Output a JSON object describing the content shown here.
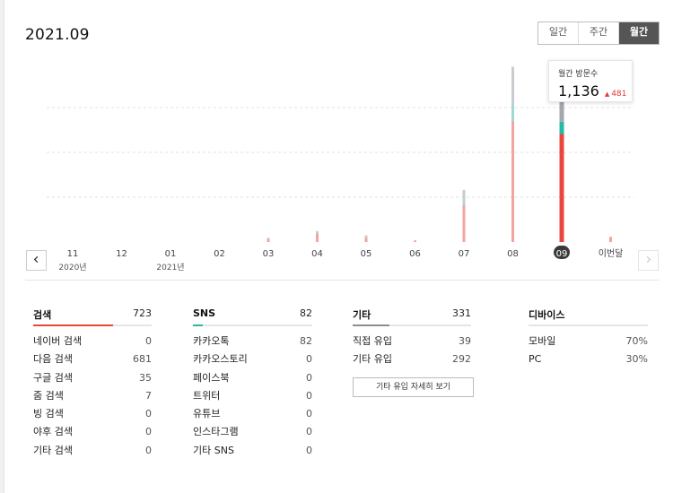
{
  "header": {
    "title": "2021.09",
    "tabs": [
      {
        "label": "일간",
        "active": false
      },
      {
        "label": "주간",
        "active": false
      },
      {
        "label": "월간",
        "active": true
      }
    ]
  },
  "tooltip": {
    "label": "월간 방문수",
    "value": "1,136",
    "arrow": "▲",
    "delta": "481"
  },
  "nav": {
    "prev_icon": "chevron-left-icon",
    "next_icon": "chevron-right-icon"
  },
  "chart_data": {
    "type": "bar",
    "stacked": true,
    "categories": [
      "11",
      "12",
      "01",
      "02",
      "03",
      "04",
      "05",
      "06",
      "07",
      "08",
      "09",
      "이번달"
    ],
    "year_labels": [
      {
        "index": 0,
        "text": "2020년"
      },
      {
        "index": 2,
        "text": "2021년"
      }
    ],
    "selected_index": 10,
    "series": [
      {
        "values": [
          0,
          0,
          0,
          0,
          23,
          55,
          32,
          9,
          247,
          807,
          723
        ],
        "color": "#f3a59d",
        "active_color": "#e8483b"
      },
      {
        "values": [
          0,
          0,
          0,
          0,
          2,
          8,
          5,
          1,
          18,
          108,
          82
        ],
        "color": "#9edad2",
        "active_color": "#27b9a5"
      },
      {
        "values": [
          0,
          0,
          0,
          0,
          4,
          10,
          8,
          2,
          83,
          258,
          331
        ],
        "color": "#c8cbcf",
        "active_color": "#a2a6ad"
      }
    ],
    "current_month_value": 35,
    "current_month_color": "#f3a59d",
    "ylim": [
      0,
      1200
    ],
    "grid": true
  },
  "stats": {
    "search": {
      "title": "검색",
      "total": "723",
      "color": "#e8483b",
      "rows": [
        {
          "label": "네이버 검색",
          "value": "0"
        },
        {
          "label": "다음 검색",
          "value": "681"
        },
        {
          "label": "구글 검색",
          "value": "35"
        },
        {
          "label": "줌 검색",
          "value": "7"
        },
        {
          "label": "빙 검색",
          "value": "0"
        },
        {
          "label": "야후 검색",
          "value": "0"
        },
        {
          "label": "기타 검색",
          "value": "0"
        }
      ]
    },
    "sns": {
      "title": "SNS",
      "total": "82",
      "color": "#27b9a5",
      "rows": [
        {
          "label": "카카오톡",
          "value": "82"
        },
        {
          "label": "카카오스토리",
          "value": "0"
        },
        {
          "label": "페이스북",
          "value": "0"
        },
        {
          "label": "트위터",
          "value": "0"
        },
        {
          "label": "유튜브",
          "value": "0"
        },
        {
          "label": "인스타그램",
          "value": "0"
        },
        {
          "label": "기타 SNS",
          "value": "0"
        }
      ]
    },
    "etc": {
      "title": "기타",
      "total": "331",
      "color": "#a2a6ad",
      "rows": [
        {
          "label": "직접 유입",
          "value": "39"
        },
        {
          "label": "기타 유입",
          "value": "292"
        }
      ],
      "button_label": "기타 유입 자세히 보기"
    },
    "device": {
      "title": "디바이스",
      "rows": [
        {
          "label": "모바일",
          "value": "70%"
        },
        {
          "label": "PC",
          "value": "30%"
        }
      ]
    }
  }
}
